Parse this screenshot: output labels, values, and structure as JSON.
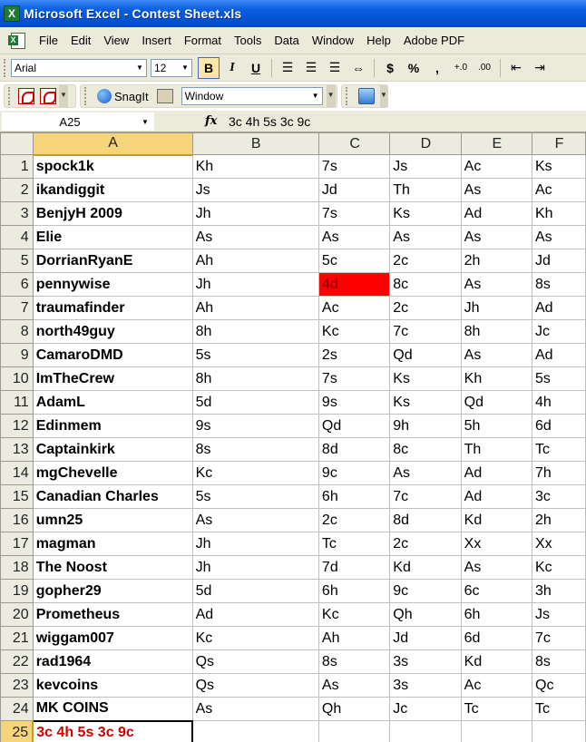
{
  "window": {
    "title": "Microsoft Excel - Contest Sheet.xls"
  },
  "menu": [
    "File",
    "Edit",
    "View",
    "Insert",
    "Format",
    "Tools",
    "Data",
    "Window",
    "Help",
    "Adobe PDF"
  ],
  "format_toolbar": {
    "font": "Arial",
    "size": "12",
    "bold": "B",
    "italic": "I",
    "underline": "U",
    "currency": "$",
    "percent": "%",
    "comma": ","
  },
  "toolbar2": {
    "snagit": "SnagIt",
    "window_combo": "Window"
  },
  "formula_bar": {
    "name_box": "A25",
    "fx": "fx",
    "formula": "3c 4h 5s 3c 9c"
  },
  "columns": [
    "A",
    "B",
    "C",
    "D",
    "E",
    "F"
  ],
  "selected_cell": "A25",
  "highlighted_cell": {
    "row": 6,
    "col": "C",
    "color": "#ff0000"
  },
  "rows": [
    {
      "n": "1",
      "cells": [
        "spock1k",
        "Kh",
        "7s",
        "Js",
        "Ac",
        "Ks"
      ]
    },
    {
      "n": "2",
      "cells": [
        "ikandiggit",
        "Js",
        "Jd",
        "Th",
        "As",
        "Ac"
      ]
    },
    {
      "n": "3",
      "cells": [
        "BenjyH 2009",
        "Jh",
        "7s",
        "Ks",
        "Ad",
        "Kh"
      ]
    },
    {
      "n": "4",
      "cells": [
        "Elie",
        "As",
        "As",
        "As",
        "As",
        "As"
      ]
    },
    {
      "n": "5",
      "cells": [
        "DorrianRyanE",
        "Ah",
        "5c",
        "2c",
        "2h",
        "Jd"
      ]
    },
    {
      "n": "6",
      "cells": [
        "pennywise",
        "Jh",
        "4d",
        "8c",
        "As",
        "8s"
      ]
    },
    {
      "n": "7",
      "cells": [
        "traumafinder",
        "Ah",
        "Ac",
        "2c",
        "Jh",
        "Ad"
      ]
    },
    {
      "n": "8",
      "cells": [
        "north49guy",
        "8h",
        "Kc",
        "7c",
        "8h",
        "Jc"
      ]
    },
    {
      "n": "9",
      "cells": [
        "CamaroDMD",
        "5s",
        "2s",
        "Qd",
        "As",
        "Ad"
      ]
    },
    {
      "n": "10",
      "cells": [
        "ImTheCrew",
        "8h",
        "7s",
        "Ks",
        "Kh",
        "5s"
      ]
    },
    {
      "n": "11",
      "cells": [
        "AdamL",
        "5d",
        "9s",
        "Ks",
        "Qd",
        "4h"
      ]
    },
    {
      "n": "12",
      "cells": [
        "Edinmem",
        "9s",
        "Qd",
        "9h",
        "5h",
        "6d"
      ]
    },
    {
      "n": "13",
      "cells": [
        "Captainkirk",
        "8s",
        "8d",
        "8c",
        "Th",
        "Tc"
      ]
    },
    {
      "n": "14",
      "cells": [
        "mgChevelle",
        "Kc",
        "9c",
        "As",
        "Ad",
        "7h"
      ]
    },
    {
      "n": "15",
      "cells": [
        "Canadian Charles",
        "5s",
        "6h",
        "7c",
        "Ad",
        "3c"
      ]
    },
    {
      "n": "16",
      "cells": [
        "umn25",
        "As",
        "2c",
        "8d",
        "Kd",
        "2h"
      ]
    },
    {
      "n": "17",
      "cells": [
        "magman",
        "Jh",
        "Tc",
        "2c",
        "Xx",
        "Xx"
      ]
    },
    {
      "n": "18",
      "cells": [
        "The Noost",
        "Jh",
        "7d",
        "Kd",
        "As",
        "Kc"
      ]
    },
    {
      "n": "19",
      "cells": [
        "gopher29",
        "5d",
        "6h",
        "9c",
        "6c",
        "3h"
      ]
    },
    {
      "n": "20",
      "cells": [
        "Prometheus",
        "Ad",
        "Kc",
        "Qh",
        "6h",
        "Js"
      ]
    },
    {
      "n": "21",
      "cells": [
        "wiggam007",
        "Kc",
        "Ah",
        "Jd",
        "6d",
        "7c"
      ]
    },
    {
      "n": "22",
      "cells": [
        "rad1964",
        "Qs",
        "8s",
        "3s",
        "Kd",
        "8s"
      ]
    },
    {
      "n": "23",
      "cells": [
        "kevcoins",
        "Qs",
        "As",
        "3s",
        "Ac",
        "Qc"
      ]
    },
    {
      "n": "24",
      "cells": [
        "MK COINS",
        "As",
        "Qh",
        "Jc",
        "Tc",
        "Tc"
      ]
    },
    {
      "n": "25",
      "cells": [
        "3c 4h 5s 3c 9c",
        "",
        "",
        "",
        "",
        ""
      ]
    }
  ]
}
